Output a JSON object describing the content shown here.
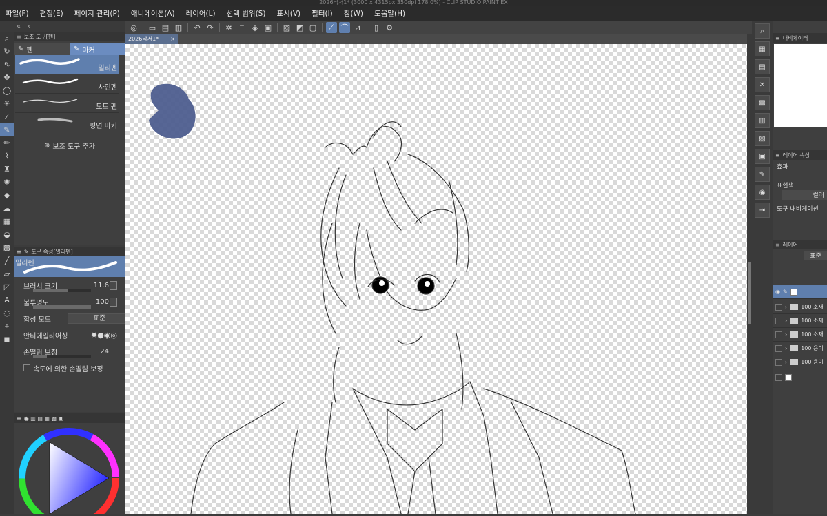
{
  "window": {
    "title": "2026낙서1* (3000 x 4315px 350dpi 178.0%) - CLIP STUDIO PAINT EX"
  },
  "menu": [
    "파일(F)",
    "편집(E)",
    "페이지 관리(P)",
    "애니메이션(A)",
    "레이어(L)",
    "선택 범위(S)",
    "표시(V)",
    "필터(I)",
    "창(W)",
    "도움말(H)"
  ],
  "subtool_panel": {
    "header": "보조 도구[펜]",
    "tabs": [
      "펜",
      "마커"
    ],
    "brushes": [
      "밀리펜",
      "사인펜",
      "도트 펜",
      "평면 마커"
    ],
    "add_label": "보조 도구 추가"
  },
  "tool_property": {
    "header": "도구 속성[밀리펜]",
    "brush_name": "밀리펜",
    "brush_size_label": "브러시 크기",
    "brush_size_value": "11.6",
    "opacity_label": "불투명도",
    "opacity_value": "100",
    "blend_label": "합성 모드",
    "blend_value": "표준",
    "antialias_label": "안티에일리어싱",
    "stabilization_label": "손떨림 보정",
    "stabilization_value": "24",
    "speed_stab_label": "속도에 의한 손떨림 보정"
  },
  "document": {
    "tab_label": "2026낙서1*",
    "close_icon": "×"
  },
  "right_panel": {
    "navigator_label": "내비게이터",
    "layer_property_label": "레이어 속성",
    "effect_label": "효과",
    "expression_label": "표현색",
    "color_label": "컬러",
    "tool_nav_label": "도구 내비게이션",
    "layer_label": "레이어",
    "blend_value": "표준",
    "layer_rows": [
      "100 소재",
      "100 소재",
      "100 소재",
      "100 용이",
      "100 용이"
    ]
  },
  "colors": {
    "accent": "#5f7fae",
    "paint_blob": "#4e5e8f",
    "bg": "#3f3f3f"
  }
}
